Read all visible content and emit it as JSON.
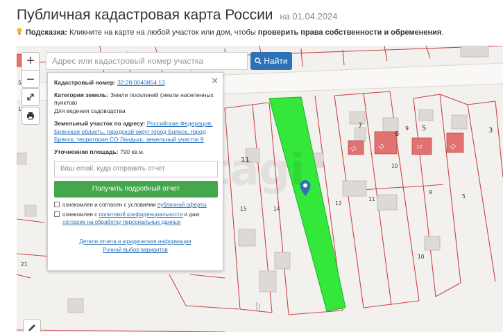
{
  "header": {
    "title": "Публичная кадастровая карта России",
    "date": "на 01.04.2024"
  },
  "hint": {
    "label": "Подсказка:",
    "text_before": "Кликните на карте на любой участок или дом, чтобы",
    "text_bold": "проверить права собственности и обременения",
    "text_after": "."
  },
  "map_controls": {
    "zoom_in": "+",
    "zoom_out": "−"
  },
  "search": {
    "placeholder": "Адрес или кадастровый номер участка",
    "button_label": "Найти"
  },
  "popup": {
    "cadastral_label": "Кадастровый номер:",
    "cadastral_value": "32:28:0040854:13",
    "category_label": "Категория земель:",
    "category_value": "Земли поселений (земли населенных пунктов)",
    "usage": "Для ведения садоводства",
    "address_label": "Земельный участок по адресу:",
    "address_value": "Российская Федерация, Брянская область, городской округ город Брянск, город Брянск, территория СО Ландыш, земельный участок 9",
    "area_label": "Уточненная площадь:",
    "area_value": "790 кв.м.",
    "email_placeholder": "Ваш email, куда отправить отчет",
    "report_button": "Получить подробный отчет",
    "consent1_text": "ознакомлен и согласен с условиями",
    "consent1_link": "публичной оферты",
    "consent2_text": "ознакомлен с",
    "consent2_link": "политикой конфиденциальности",
    "consent2_mid": "и даю",
    "consent2_link2": "согласие на обработку персональных данных",
    "details_link": "Детали отчета и юридическая информация",
    "manual_link": "Ручной выбор вариантов"
  },
  "map_labels": {
    "house_numbers": [
      "7",
      "6",
      "9",
      "5",
      "3",
      "11",
      "15",
      "14",
      "12",
      "11",
      "10",
      "9",
      "5",
      "10",
      "21",
      "5",
      "12"
    ],
    "badges": [
      "12",
      "12",
      "12",
      "12"
    ],
    "watermark": "etagi"
  },
  "colors": {
    "brand_blue": "#2d72b8",
    "selected_parcel": "#33e83a",
    "report_button": "#45a74d",
    "building_red": "#e07272",
    "boundary_red": "#c84646"
  },
  "icons": {
    "search_button": "search-icon",
    "hint": "lightbulb-icon",
    "fullscreen": "expand-icon",
    "print": "printer-icon",
    "edit": "pencil-icon",
    "marker": "map-pin-icon",
    "close": "close-icon"
  }
}
